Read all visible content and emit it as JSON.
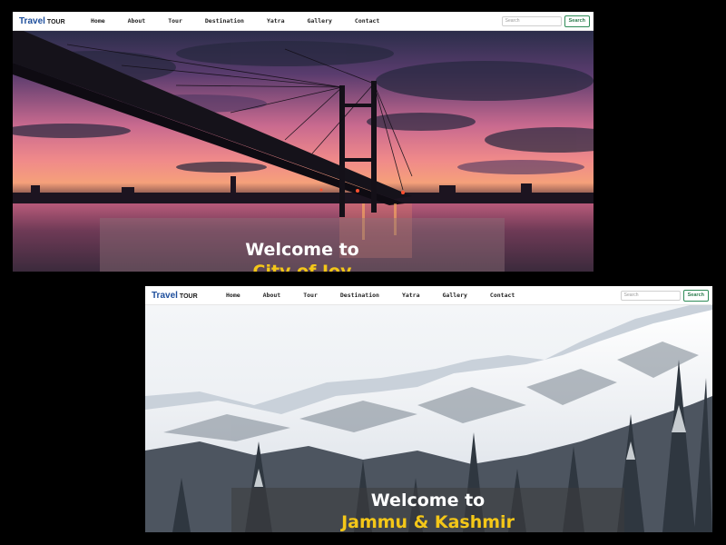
{
  "screens": [
    {
      "brand": {
        "primary": "Travel",
        "secondary": "TOUR"
      },
      "nav": [
        "Home",
        "About",
        "Tour",
        "Destination",
        "Yatra",
        "Gallery",
        "Contact"
      ],
      "search": {
        "placeholder": "Search",
        "button": "Search"
      },
      "hero": {
        "line1": "Welcome to",
        "line2": "City of Joy",
        "scene": "sunset-bridge-over-river"
      }
    },
    {
      "brand": {
        "primary": "Travel",
        "secondary": "TOUR"
      },
      "nav": [
        "Home",
        "About",
        "Tour",
        "Destination",
        "Yatra",
        "Gallery",
        "Contact"
      ],
      "search": {
        "placeholder": "Search",
        "button": "Search"
      },
      "hero": {
        "line1": "Welcome to",
        "line2": "Jammu & Kashmir",
        "scene": "snowy-mountains-with-pines"
      }
    }
  ],
  "colors": {
    "brand_blue": "#1d4e9c",
    "accent_yellow": "#f4c718",
    "search_green": "#2e8b57",
    "page_bg": "#000000"
  }
}
